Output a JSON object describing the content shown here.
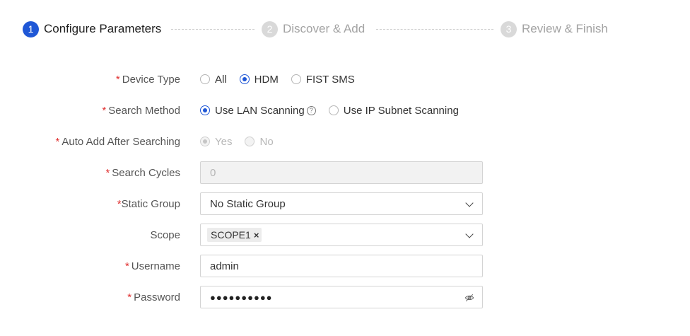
{
  "steps": [
    {
      "num": "1",
      "label": "Configure Parameters"
    },
    {
      "num": "2",
      "label": "Discover & Add"
    },
    {
      "num": "3",
      "label": "Review & Finish"
    }
  ],
  "form": {
    "device_type": {
      "label": "Device Type",
      "options": [
        "All",
        "HDM",
        "FIST SMS"
      ],
      "selected": "HDM"
    },
    "search_method": {
      "label": "Search Method",
      "options": [
        "Use LAN Scanning",
        "Use IP Subnet Scanning"
      ],
      "selected": "Use LAN Scanning",
      "help_icon": "question-circle-icon"
    },
    "auto_add": {
      "label": "Auto Add After Searching",
      "options": [
        "Yes",
        "No"
      ],
      "selected": "Yes"
    },
    "search_cycles": {
      "label": "Search Cycles",
      "placeholder": "0"
    },
    "static_group": {
      "label": "Static Group",
      "value": "No Static Group"
    },
    "scope": {
      "label": "Scope",
      "tags": [
        "SCOPE1"
      ],
      "tag_remove": "×"
    },
    "username": {
      "label": "Username",
      "value": "admin"
    },
    "password": {
      "label": "Password",
      "value": "●●●●●●●●●●",
      "toggle_icon": "eye-hidden-icon"
    }
  },
  "required_mark": "*",
  "colors": {
    "accent": "#1f57d6",
    "required": "#e03131"
  }
}
